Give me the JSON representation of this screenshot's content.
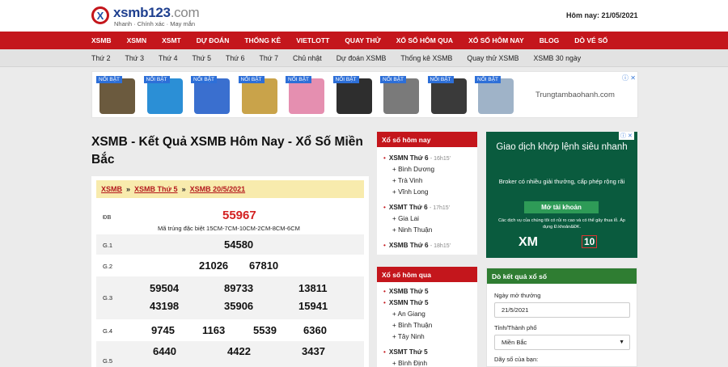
{
  "site": {
    "logo_mark": "X",
    "logo_name": "xsmb123",
    "logo_suffix": ".com",
    "slogan": "Nhanh · Chính xác · May mắn",
    "today": "Hôm nay: 21/05/2021"
  },
  "main_nav": [
    "XSMB",
    "XSMN",
    "XSMT",
    "DỰ ĐOÁN",
    "THỐNG KÊ",
    "VIETLOTT",
    "QUAY THỬ",
    "XỔ SỐ HÔM QUA",
    "XỔ SỐ HÔM NAY",
    "BLOG",
    "DÒ VÉ SỐ"
  ],
  "sub_nav": [
    "Thứ 2",
    "Thứ 3",
    "Thứ 4",
    "Thứ 5",
    "Thứ 6",
    "Thứ 7",
    "Chủ nhật",
    "Dự đoán XSMB",
    "Thống kê XSMB",
    "Quay thử XSMB",
    "XSMB 30 ngày"
  ],
  "ad_bar": {
    "tag": "NỔI BẬT",
    "domain": "Trungtambaohanh.com",
    "products": [
      {
        "icon": "phones-icon",
        "color": "#6b5a3e"
      },
      {
        "icon": "phone-blue-icon",
        "color": "#2b8fd6"
      },
      {
        "icon": "phone-galaxy-icon",
        "color": "#3a6fcf"
      },
      {
        "icon": "phone-gold-icon",
        "color": "#c9a34a"
      },
      {
        "icon": "gamepad-pink-icon",
        "color": "#e58fb0"
      },
      {
        "icon": "phone-black-icon",
        "color": "#2e2e2e"
      },
      {
        "icon": "ssd-box-icon",
        "color": "#7a7a7a"
      },
      {
        "icon": "smartwatch-icon",
        "color": "#3a3a3a"
      },
      {
        "icon": "monitor-icon",
        "color": "#9fb3c8"
      }
    ]
  },
  "page_title": "XSMB - Kết Quả XSMB Hôm Nay - Xổ Số Miền Bắc",
  "breadcrumb": [
    "XSMB",
    "XSMB Thứ 5",
    "XSMB 20/5/2021"
  ],
  "results": {
    "db_label": "ĐB",
    "db_number": "55967",
    "db_code": "Mã trúng đặc biệt 15CM-7CM-10CM-2CM-8CM-6CM",
    "g1": {
      "label": "G.1",
      "numbers": [
        "54580"
      ]
    },
    "g2": {
      "label": "G.2",
      "numbers": [
        "21026",
        "67810"
      ]
    },
    "g3": {
      "label": "G.3",
      "numbers": [
        "59504",
        "89733",
        "13811",
        "43198",
        "35906",
        "15941"
      ]
    },
    "g4": {
      "label": "G.4",
      "numbers": [
        "9745",
        "1163",
        "5539",
        "6360"
      ]
    },
    "g5": {
      "label": "G.5",
      "numbers": [
        "6440",
        "4422",
        "3437"
      ]
    }
  },
  "today_box": {
    "title": "Xổ số hôm nay",
    "groups": [
      {
        "name": "XSMN Thứ 6",
        "time": "- 16h15'",
        "items": [
          "Bình Dương",
          "Trà Vinh",
          "Vĩnh Long"
        ]
      },
      {
        "name": "XSMT Thứ 6",
        "time": "- 17h15'",
        "items": [
          "Gia Lai",
          "Ninh Thuận"
        ]
      },
      {
        "name": "XSMB Thứ 6",
        "time": "- 18h15'",
        "items": []
      }
    ]
  },
  "yesterday_box": {
    "title": "Xổ số hôm qua",
    "groups": [
      {
        "name": "XSMB Thứ 5",
        "items": []
      },
      {
        "name": "XSMN Thứ 5",
        "items": [
          "An Giang",
          "Bình Thuận",
          "Tây Ninh"
        ]
      },
      {
        "name": "XSMT Thứ 5",
        "items": [
          "Bình Định"
        ]
      }
    ]
  },
  "xm_ad": {
    "headline": "Giao dịch khớp lệnh siêu nhanh",
    "sub": "Broker có nhiều giải thưởng, cấp phép rộng rãi",
    "button": "Mở tài khoản",
    "small": "Các dịch vụ của chúng tôi có rủi ro cao và có thể gây thua lỗ. Áp dụng Đ.khoản&ĐK.",
    "logo": "XM",
    "badge": "10",
    "adinfo": "ⓘ ✕"
  },
  "lookup": {
    "title": "Dò kết quả xổ số",
    "date_label": "Ngày mở thưởng",
    "date_value": "21/5/2021",
    "city_label": "Tỉnh/Thành phố",
    "city_value": "Miền Bắc",
    "numbers_label": "Dãy số của bạn:"
  },
  "colors": {
    "brand_red": "#c4161c",
    "brand_blue": "#1e3f8f",
    "lookup_green": "#2f7d32",
    "xm_green": "#0a5b3e"
  }
}
